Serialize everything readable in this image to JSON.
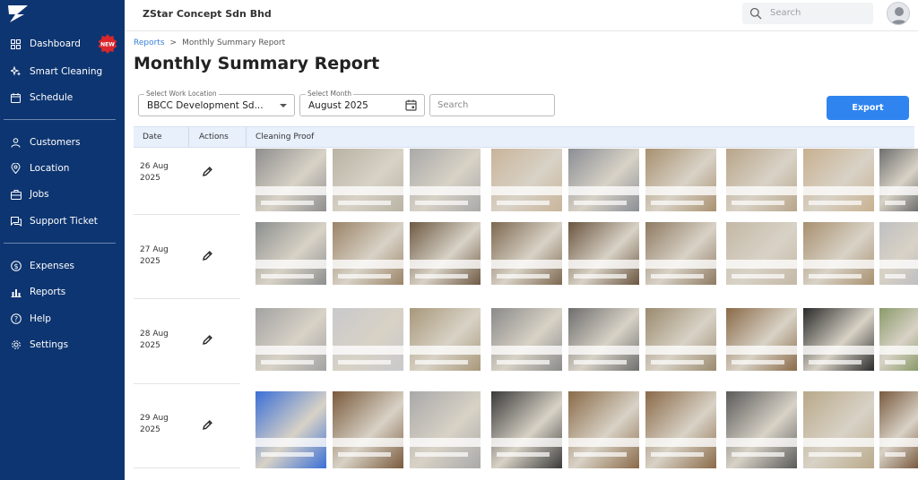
{
  "header": {
    "company": "ZStar Concept Sdn Bhd",
    "search_placeholder": "Search"
  },
  "sidebar": {
    "groups": [
      [
        {
          "label": "Dashboard",
          "icon": "dashboard-icon",
          "badge": "NEW"
        },
        {
          "label": "Smart Cleaning",
          "icon": "sparkle-icon"
        },
        {
          "label": "Schedule",
          "icon": "calendar-icon"
        }
      ],
      [
        {
          "label": "Customers",
          "icon": "person-icon"
        },
        {
          "label": "Location",
          "icon": "location-pin-icon"
        },
        {
          "label": "Jobs",
          "icon": "briefcase-icon"
        },
        {
          "label": "Support Ticket",
          "icon": "chat-icon"
        }
      ],
      [
        {
          "label": "Expenses",
          "icon": "dollar-icon"
        },
        {
          "label": "Reports",
          "icon": "bar-chart-icon"
        },
        {
          "label": "Help",
          "icon": "help-circle-icon"
        },
        {
          "label": "Settings",
          "icon": "gear-icon"
        }
      ]
    ]
  },
  "breadcrumb": {
    "parent": "Reports",
    "separator": ">",
    "current": "Monthly Summary Report"
  },
  "page": {
    "title": "Monthly Summary Report"
  },
  "filters": {
    "location": {
      "label": "Select Work Location",
      "value": "BBCC Development Sd..."
    },
    "month": {
      "label": "Select Month",
      "value": "August 2025"
    },
    "search": {
      "placeholder": "Search"
    },
    "export_label": "Export"
  },
  "table": {
    "columns": [
      "Date",
      "Actions",
      "Cleaning Proof"
    ],
    "rows": [
      {
        "date_line1": "26 Aug",
        "date_line2": "2025"
      },
      {
        "date_line1": "27 Aug",
        "date_line2": "2025"
      },
      {
        "date_line1": "28 Aug",
        "date_line2": "2025"
      },
      {
        "date_line1": "29 Aug",
        "date_line2": "2025"
      }
    ]
  },
  "colors": {
    "sidebar_bg": "#0d3571",
    "accent": "#2f84f0",
    "table_header_bg": "#e8f0fc",
    "badge_red": "#d9262c"
  }
}
